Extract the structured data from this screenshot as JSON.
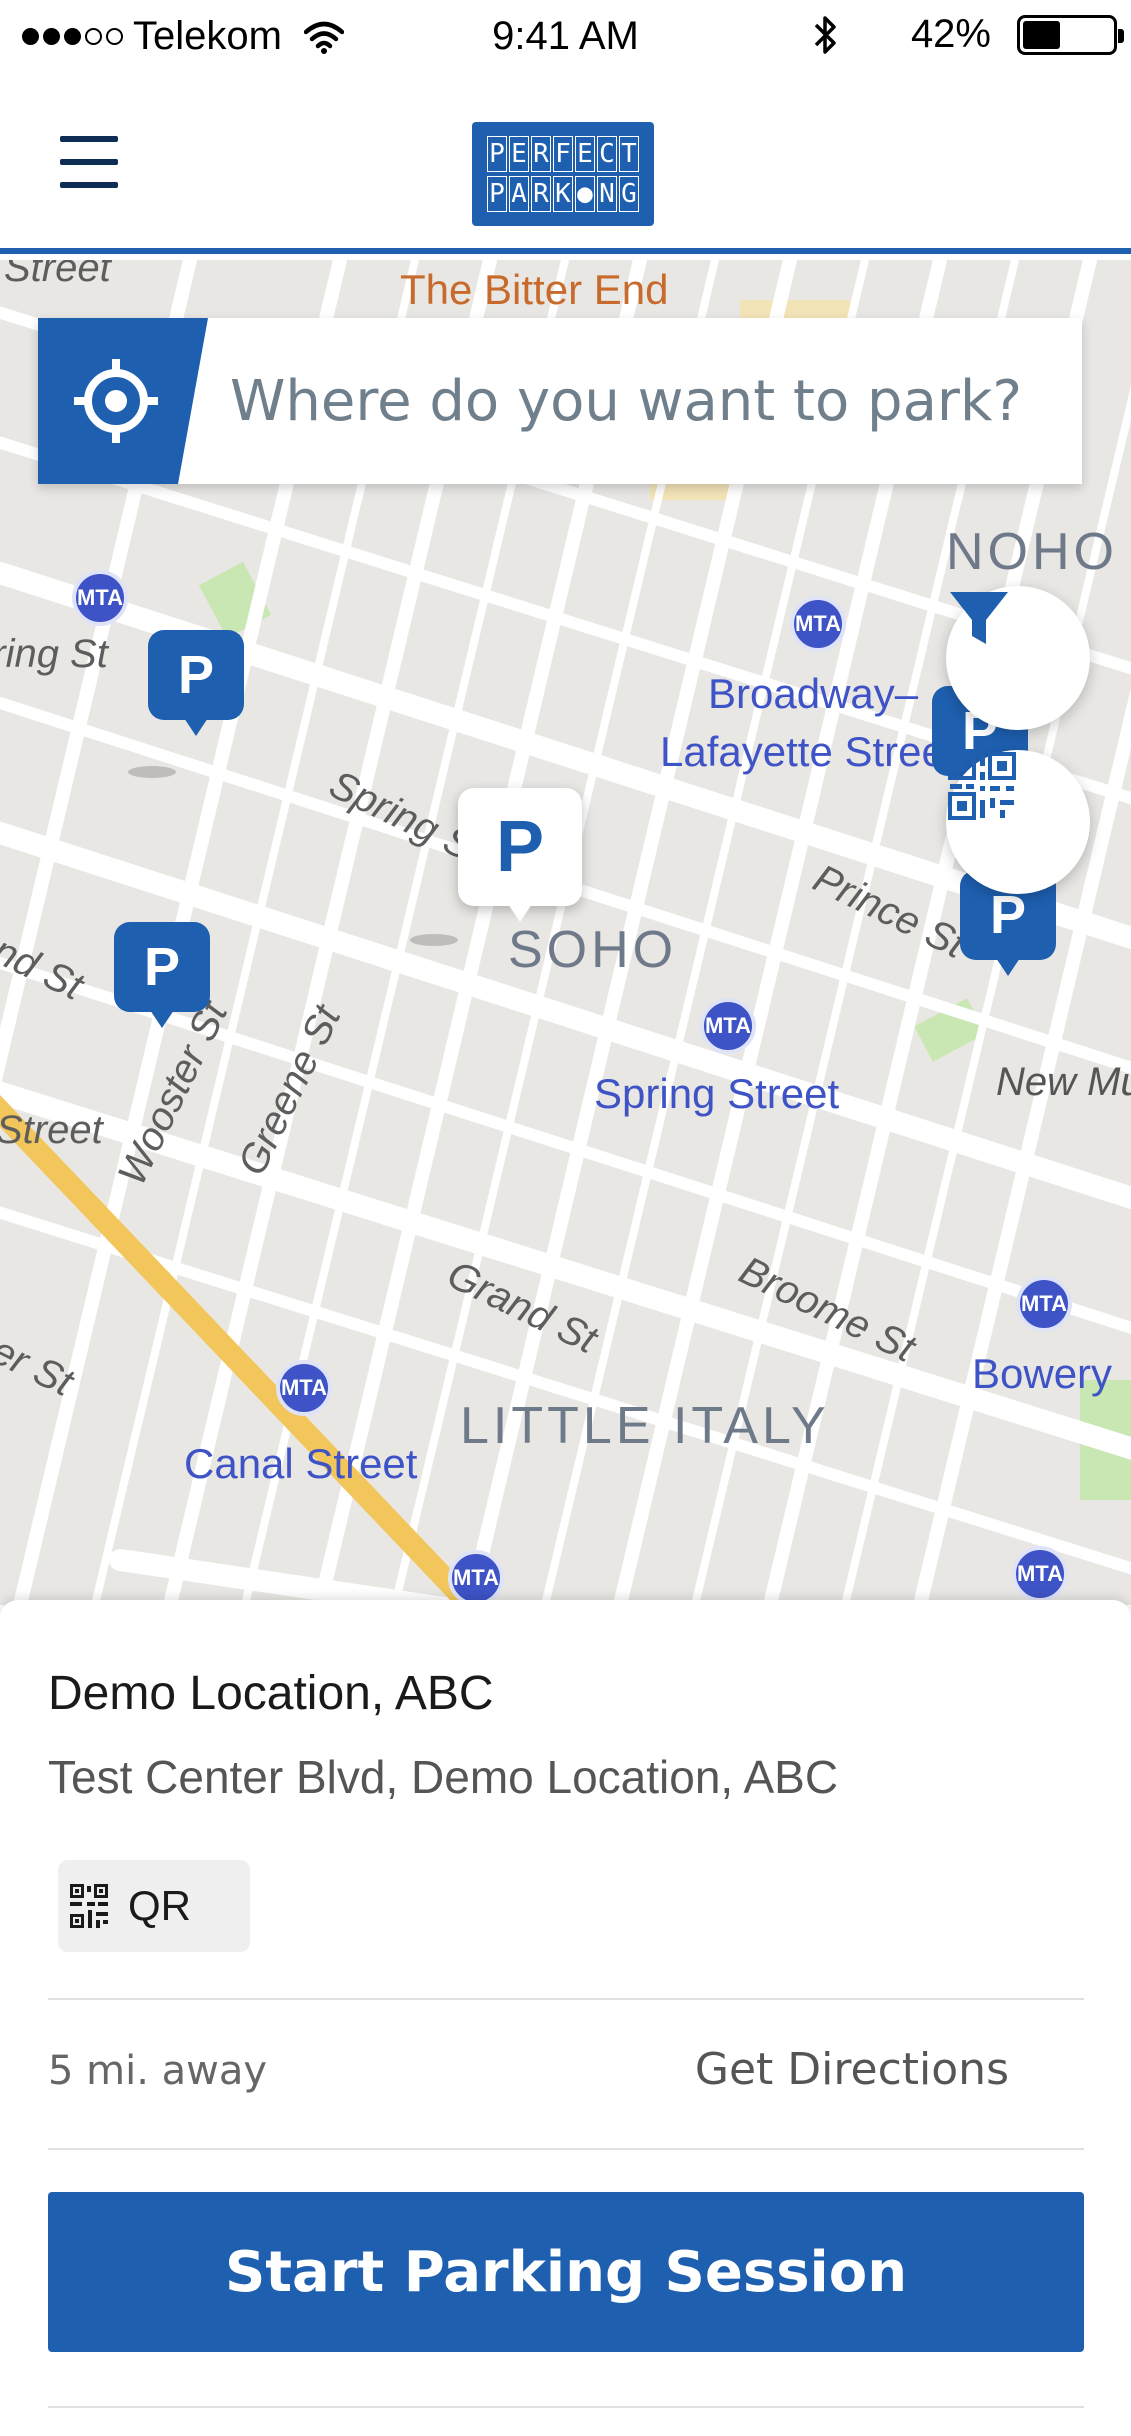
{
  "status_bar": {
    "carrier": "Telekom",
    "signal_bars_filled": 3,
    "signal_bars_total": 5,
    "time": "9:41 AM",
    "battery_percent_label": "42%",
    "battery_level": 0.42,
    "icons": [
      "wifi-icon",
      "bluetooth-icon",
      "battery-icon"
    ]
  },
  "header": {
    "menu_icon": "hamburger-menu-icon",
    "logo_line1": [
      "P",
      "E",
      "R",
      "F",
      "E",
      "C",
      "T"
    ],
    "logo_line2": [
      "P",
      "A",
      "R",
      "K",
      "●",
      "N",
      "G"
    ]
  },
  "search": {
    "placeholder": "Where do you want to park?",
    "locate_icon": "crosshair-icon"
  },
  "map": {
    "streets": [
      "Spring St",
      "Prince St",
      "Broome St",
      "Grand St",
      "Wooster St",
      "Greene St",
      "Street",
      "Street",
      "pring St",
      "nd St",
      "er St"
    ],
    "districts": [
      "NOHO",
      "SOHO",
      "LITTLE ITALY"
    ],
    "stations": [
      "Broadway–",
      "Lafayette Stree",
      "Spring Street",
      "Canal Street",
      "Bowery",
      "New Mu"
    ],
    "poi": "The Bitter End",
    "metro_badge": "MTA",
    "pin_label": "P",
    "filter_icon": "filter-icon",
    "qr_icon": "qr-code-icon"
  },
  "location_card": {
    "name": "Demo Location, ABC",
    "address": "Test Center Blvd, Demo Location, ABC",
    "badge_label": "QR",
    "badge_icon": "qr-code-icon",
    "distance": "5 mi. away",
    "directions_label": "Get Directions",
    "start_button_label": "Start Parking Session"
  },
  "colors": {
    "brand_blue": "#1e5fb0",
    "navy": "#0e2d54",
    "metro_blue": "#3e53c6",
    "map_bg": "#e9e7e4",
    "road": "#ffffff",
    "highway": "#f2c65b",
    "park": "#c9e7b3"
  }
}
